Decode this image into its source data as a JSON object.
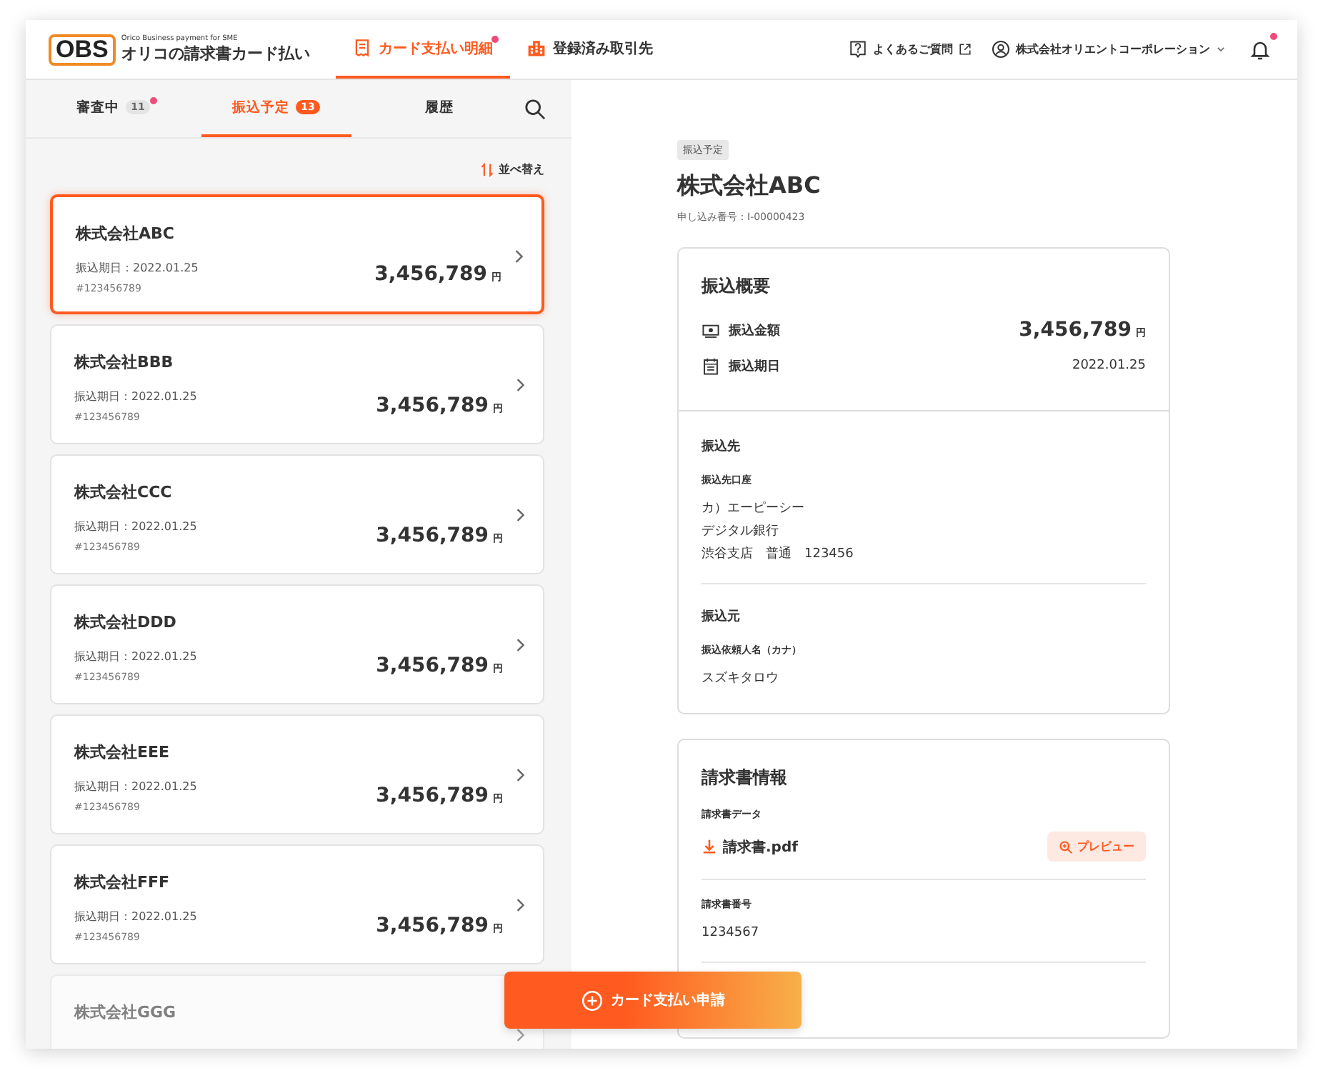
{
  "header": {
    "logo": {
      "mark": "OBS",
      "tagline": "Orico Business payment for SME",
      "name": "オリコの請求書カード払い"
    },
    "nav": [
      {
        "label": "カード支払い明細",
        "selected": true,
        "dot": true
      },
      {
        "label": "登録済み取引先",
        "selected": false,
        "dot": false
      }
    ],
    "help": "よくあるご質問",
    "account": "株式会社オリエントコーポレーション",
    "bell_dot": true
  },
  "tabs": [
    {
      "label": "審査中",
      "count": "11",
      "selected": false,
      "dot": true
    },
    {
      "label": "振込予定",
      "count": "13",
      "selected": true,
      "dot": false
    },
    {
      "label": "履歴",
      "selected": false,
      "dot": false
    }
  ],
  "sort": "並べ替え",
  "cards": [
    {
      "name": "株式会社ABC",
      "date": "振込期日：2022.01.25",
      "id": "#123456789",
      "amount": "3,456,789",
      "unit": "円",
      "selected": true
    },
    {
      "name": "株式会社BBB",
      "date": "振込期日：2022.01.25",
      "id": "#123456789",
      "amount": "3,456,789",
      "unit": "円",
      "selected": false
    },
    {
      "name": "株式会社CCC",
      "date": "振込期日：2022.01.25",
      "id": "#123456789",
      "amount": "3,456,789",
      "unit": "円",
      "selected": false
    },
    {
      "name": "株式会社DDD",
      "date": "振込期日：2022.01.25",
      "id": "#123456789",
      "amount": "3,456,789",
      "unit": "円",
      "selected": false
    },
    {
      "name": "株式会社EEE",
      "date": "振込期日：2022.01.25",
      "id": "#123456789",
      "amount": "3,456,789",
      "unit": "円",
      "selected": false
    },
    {
      "name": "株式会社FFF",
      "date": "振込期日：2022.01.25",
      "id": "#123456789",
      "amount": "3,456,789",
      "unit": "円",
      "selected": false
    },
    {
      "name": "株式会社GGG",
      "selected": false
    }
  ],
  "detail": {
    "status": "振込予定",
    "title": "株式会社ABC",
    "application_no": "申し込み番号：I-00000423",
    "summary": {
      "heading": "振込概要",
      "amount_label": "振込金額",
      "amount": "3,456,789",
      "unit": "円",
      "date_label": "振込期日",
      "date": "2022.01.25"
    },
    "payee": {
      "heading": "振込先",
      "account_label": "振込先口座",
      "lines": [
        "カ）エーピーシー",
        "デジタル銀行",
        "渋谷支店　普通　123456"
      ]
    },
    "payer": {
      "heading": "振込元",
      "name_label": "振込依頼人名（カナ）",
      "name": "スズキタロウ"
    },
    "invoice": {
      "heading": "請求書情報",
      "data_label": "請求書データ",
      "file": "請求書.pdf",
      "preview": "プレビュー",
      "number_label": "請求書番号",
      "number": "1234567"
    }
  },
  "apply_button": "カード支払い申請"
}
